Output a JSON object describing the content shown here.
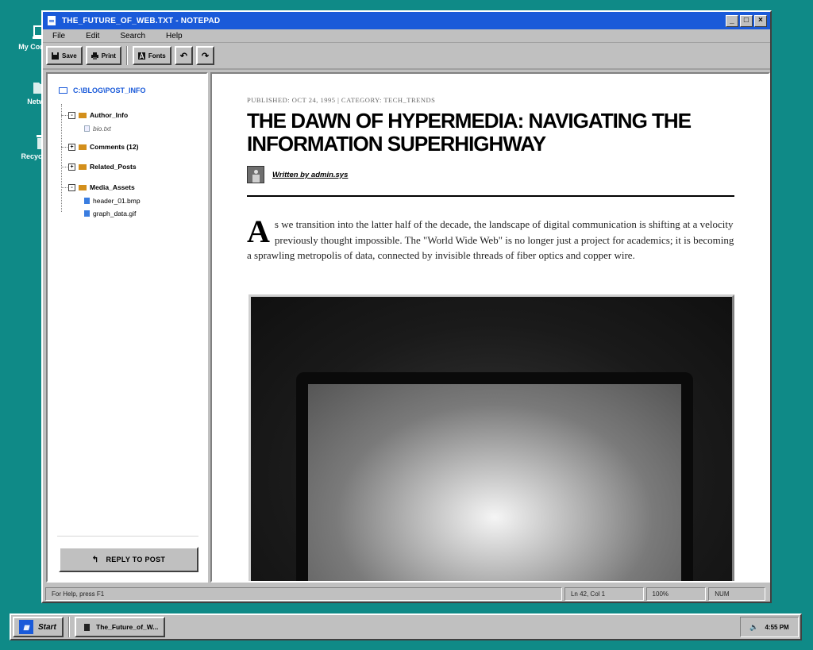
{
  "desktop": {
    "icons": [
      {
        "label": "My Computer",
        "icon": "computer-icon"
      },
      {
        "label": "Network",
        "icon": "network-icon"
      },
      {
        "label": "Recycle Bin",
        "icon": "recycle-bin-icon"
      }
    ]
  },
  "window": {
    "title": "THE_FUTURE_OF_WEB.TXT - NOTEPAD",
    "controls": {
      "minimize": "_",
      "maximize": "□",
      "close": "×"
    },
    "menu": [
      "File",
      "Edit",
      "Search",
      "Help"
    ],
    "toolbar": {
      "save": "Save",
      "print": "Print",
      "fonts": "Fonts",
      "undo_icon": "↶",
      "redo_icon": "↷"
    }
  },
  "tree": {
    "root": "C:\\BLOG\\POST_INFO",
    "nodes": [
      {
        "label": "Author_Info",
        "expander": "-",
        "type": "folder"
      },
      {
        "label": "bio.txt",
        "type": "file"
      },
      {
        "label": "Comments (12)",
        "expander": "+",
        "type": "folder"
      },
      {
        "label": "Related_Posts",
        "expander": "+",
        "type": "folder"
      },
      {
        "label": "Media_Assets",
        "expander": "-",
        "type": "folder"
      },
      {
        "label": "header_01.bmp",
        "type": "image"
      },
      {
        "label": "graph_data.gif",
        "type": "image"
      }
    ],
    "reply_button": "REPLY TO POST"
  },
  "article": {
    "meta": "PUBLISHED: OCT 24, 1995 | CATEGORY: TECH_TRENDS",
    "headline": "THE DAWN OF HYPERMEDIA: NAVIGATING THE INFORMATION SUPERHIGHWAY",
    "author": "Written by admin.sys",
    "dropcap": "A",
    "body": "s we transition into the latter half of the decade, the landscape of digital communication is shifting at a velocity previously thought impossible. The \"World Wide Web\" is no longer just a project for academics; it is becoming a sprawling metropolis of data, connected by invisible threads of fiber optics and copper wire."
  },
  "status": {
    "help": "For Help, press F1",
    "position": "Ln 42, Col 1",
    "zoom": "100%",
    "mode": "NUM"
  },
  "taskbar": {
    "start": "Start",
    "task": "The_Future_of_W...",
    "clock": "4:55 PM"
  },
  "colors": {
    "desktop": "#0f8a87",
    "titlebar": "#1a5ad9",
    "folder": "#d38f1b"
  }
}
